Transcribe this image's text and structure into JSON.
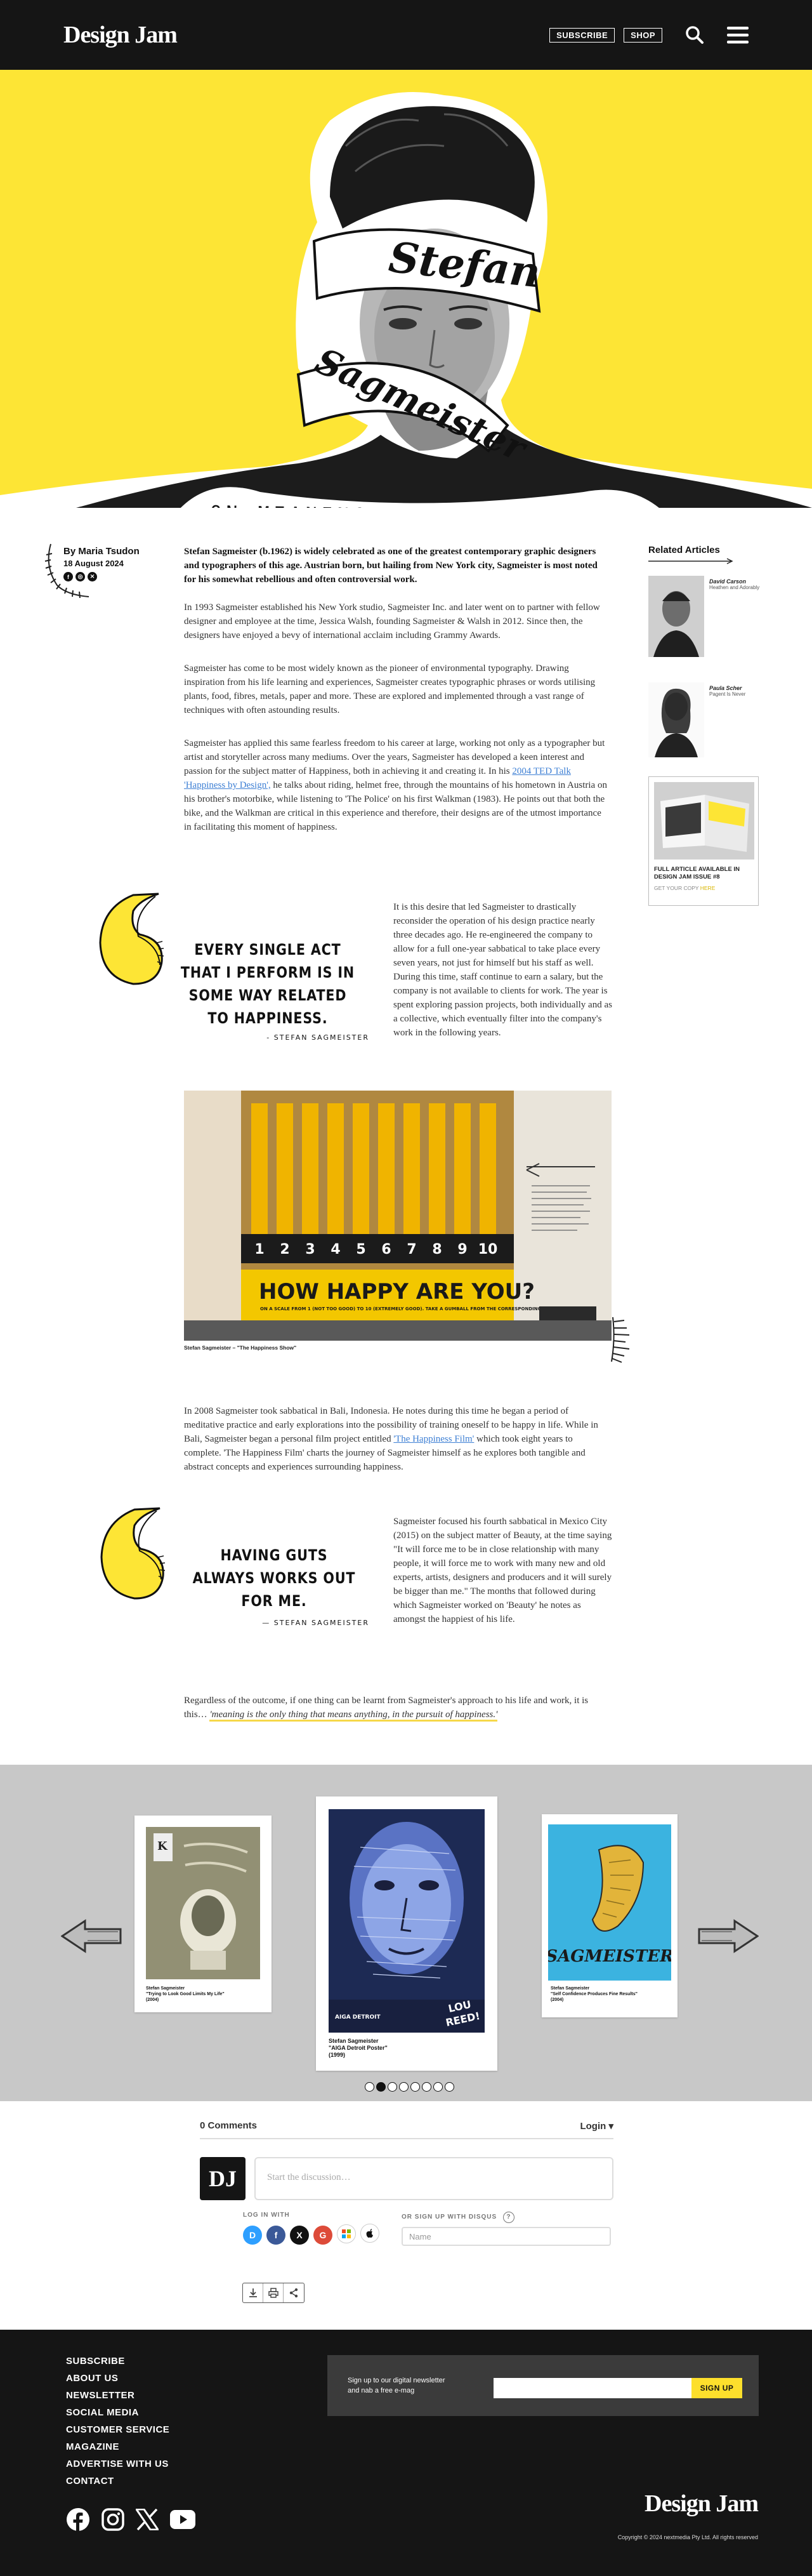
{
  "header": {
    "logo": "Design Jam",
    "subscribe_label": "SUBSCRIBE",
    "shop_label": "SHOP",
    "icons": [
      "search-icon",
      "menu-icon"
    ]
  },
  "hero": {
    "first_name": "Stefan",
    "last_name": "Sagmeister",
    "headline": "ON MEANING AND HAPPINESS"
  },
  "byline": {
    "author": "By Maria Tsudon",
    "date": "18 August 2024",
    "socials": [
      "f",
      "◎",
      "✕"
    ]
  },
  "article": {
    "lead": "Stefan Sagmeister (b.1962) is widely celebrated as one of the greatest contemporary graphic designers and typographers of this age. Austrian born, but hailing from New York city, Sagmeister is most noted for his somewhat rebellious and often controversial work.",
    "p1": "In 1993 Sagmeister established his New York studio, Sagmeister Inc. and later went on to partner with fellow designer and employee at the time, Jessica Walsh, founding Sagmeister & Walsh in 2012. Since then, the designers have enjoyed a bevy of international acclaim including Grammy Awards.",
    "p2": "Sagmeister has come to be most widely known as the pioneer of environmental typography. Drawing inspiration from his life learning and experiences, Sagmeister creates typographic phrases or words utilising plants, food, fibres, metals, paper and more. These are explored and implemented through a vast range of techniques with often astounding results.",
    "p3a": "Sagmeister has applied this same fearless freedom to his career at large, working not only as a typographer but artist and storyteller across many mediums. Over the years, Sagmeister has developed a keen interest and passion for the subject matter of Happiness, both in achieving it and creating it. In his ",
    "p3_link": "2004 TED Talk 'Happiness by Design',",
    "p3b": " he talks about riding, helmet free, through the mountains of his hometown in Austria on his brother's motorbike, while listening to 'The Police' on his first Walkman (1983). He points out that both the bike, and the Walkman are critical in this experience and therefore, their designs are of the utmost importance in facilitating this moment of happiness.",
    "p4": "It is this desire that led Sagmeister to drastically reconsider the operation of his design practice nearly three decades ago. He re-engineered the company to allow for a full one-year sabbatical to take place every seven years, not just for himself but his staff as well. During this time, staff continue to earn a salary, but the company is not available to clients for work. The year is spent exploring passion projects, both individually and as a collective, which eventually filter into the company's work in the following years.",
    "p5a": "In 2008 Sagmeister took sabbatical in Bali, Indonesia. He notes during this time he began a period of meditative practice and early explorations into the possibility of training oneself to be happy in life. While in Bali, Sagmeister began a personal film project entitled ",
    "p5_link": "'The Happiness Film'",
    "p5b": " which took eight years to complete. 'The Happiness Film' charts the journey of Sagmeister himself as he explores both tangible and abstract concepts and experiences surrounding happiness.",
    "p6": "Sagmeister focused his fourth sabbatical in Mexico City (2015) on the subject matter of Beauty, at the time saying \"It will force me to be in close relationship with many people, it will force me to work with many new and old experts, artists, designers and producers and it will surely be bigger than me.\" The months that followed during which Sagmeister worked on 'Beauty' he notes as amongst the happiest of his life.",
    "p7a": "Regardless of the outcome, if one thing can be learnt from Sagmeister's approach to his life and work, it is this… ",
    "p7_highlight": "'meaning is the only thing that means anything, in the pursuit of happiness.'"
  },
  "quotes": [
    {
      "text": "EVERY SINGLE ACT THAT I PERFORM IS IN SOME WAY RELATED TO HAPPINESS.",
      "attribution": "- STEFAN SAGMEISTER"
    },
    {
      "text": "HAVING GUTS ALWAYS WORKS OUT FOR ME.",
      "attribution": "— STEFAN SAGMEISTER"
    }
  ],
  "photo": {
    "sign": "HOW HAPPY ARE YOU?",
    "sign_sub": "ON A SCALE FROM 1 (NOT TOO GOOD) TO 10 (EXTREMELY GOOD). TAKE A GUMBALL FROM THE CORRESPONDING MACHINE",
    "numbers": [
      "1",
      "2",
      "3",
      "4",
      "5",
      "6",
      "7",
      "8",
      "9",
      "10"
    ],
    "caption": "Stefan Sagmeister – \"The Happiness Show\""
  },
  "related": {
    "title": "Related Articles",
    "items": [
      {
        "name": "David Carson",
        "sub": "Heathen and Adorably"
      },
      {
        "name": "Paula Scher",
        "sub": "Pagent Is Never"
      }
    ],
    "magazine_text": "FULL ARTICLE AVAILABLE IN DESIGN JAM ISSUE #8",
    "magazine_link_a": "GET YOUR COPY ",
    "magazine_link_b": "HERE"
  },
  "carousel": {
    "cards": [
      {
        "cap1": "Stefan Sagmeister",
        "cap2": "\"Trying to Look Good Limits My Life\"",
        "cap3": "(2004)"
      },
      {
        "cap1": "Stefan Sagmeister",
        "cap2": "\"AIGA Detroit Poster\"",
        "cap3": "(1999)",
        "poster_sub": "AIGA DETROIT"
      },
      {
        "cap1": "Stefan Sagmeister",
        "cap2": "\"Self Confidence Produces Fine Results\"",
        "cap3": "(2004)",
        "poster_name": "SAGMEISTER"
      }
    ],
    "dots": 8,
    "active_dot": 1
  },
  "comments": {
    "count_label": "0 Comments",
    "login_label": "Login ▾",
    "avatar": "DJ",
    "placeholder": "Start the discussion…",
    "login_with": "LOG IN WITH",
    "signup_label": "OR SIGN UP WITH DISQUS",
    "help": "?",
    "name_placeholder": "Name",
    "providers": [
      {
        "label": "D",
        "color": "#2e9fff"
      },
      {
        "label": "f",
        "color": "#3b5998"
      },
      {
        "label": "X",
        "color": "#111111"
      },
      {
        "label": "G",
        "color": "#dd4b39"
      },
      {
        "label": "⊞",
        "color": "#ffffff"
      },
      {
        "label": "",
        "color": "#ffffff"
      }
    ]
  },
  "footer": {
    "links": [
      "SUBSCRIBE",
      "ABOUT US",
      "NEWSLETTER",
      "SOCIAL MEDIA",
      "CUSTOMER SERVICE",
      "MAGAZINE",
      "ADVERTISE WITH US",
      "CONTACT"
    ],
    "newsletter_line1": "Sign up to our digital newsletter",
    "newsletter_line2": "and nab a free e-mag",
    "signup_btn": "SIGN UP",
    "logo": "Design Jam",
    "copyright": "Copyright © 2024 nextmedia Pty Ltd. All rights reserved",
    "social_icons": [
      "facebook-icon",
      "instagram-icon",
      "x-icon",
      "youtube-icon"
    ]
  },
  "colors": {
    "accent_yellow": "#fde535",
    "dark": "#151515",
    "link_blue": "#3d7fd4"
  }
}
